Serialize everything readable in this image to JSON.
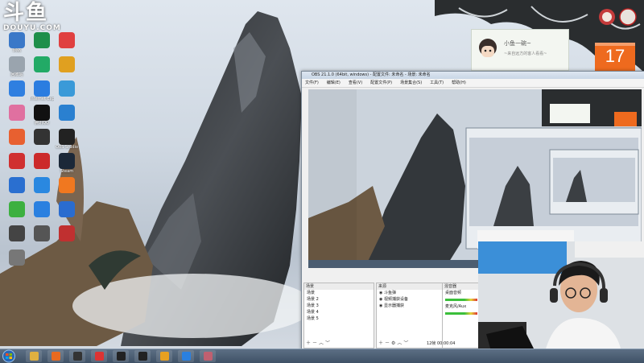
{
  "watermark": {
    "logo_chars": "斗鱼",
    "site": "DOUYU.COM"
  },
  "desktop_icons": [
    {
      "label": "网络",
      "color": "#3a78c8",
      "icon": "network-icon"
    },
    {
      "label": "",
      "color": "#1e8f4a",
      "icon": "app-icon"
    },
    {
      "label": "",
      "color": "#e04040",
      "icon": "app-icon"
    },
    {
      "label": "回收站",
      "color": "#9aa4ae",
      "icon": "recycle-bin-icon"
    },
    {
      "label": "",
      "color": "#22aa66",
      "icon": "wechat-icon"
    },
    {
      "label": "",
      "color": "#e0a020",
      "icon": "app-icon"
    },
    {
      "label": "",
      "color": "#2f7fe0",
      "icon": "app-icon"
    },
    {
      "label": "Internet Explorer",
      "color": "#2b7de0",
      "icon": "ie-icon"
    },
    {
      "label": "",
      "color": "#3a9ad8",
      "icon": "app-icon"
    },
    {
      "label": "",
      "color": "#e070a0",
      "icon": "app-icon"
    },
    {
      "label": "腾讯QQ",
      "color": "#111111",
      "icon": "qq-icon"
    },
    {
      "label": "",
      "color": "#2a80d0",
      "icon": "app-icon"
    },
    {
      "label": "",
      "color": "#e86030",
      "icon": "app-icon"
    },
    {
      "label": "",
      "color": "#333333",
      "icon": "app-icon"
    },
    {
      "label": "OBS Studio",
      "color": "#222222",
      "icon": "obs-icon"
    },
    {
      "label": "",
      "color": "#d03030",
      "icon": "app-icon"
    },
    {
      "label": "",
      "color": "#cc2a2a",
      "icon": "app-icon"
    },
    {
      "label": "Steam",
      "color": "#1b2838",
      "icon": "steam-icon"
    },
    {
      "label": "",
      "color": "#2a6fd0",
      "icon": "app-icon"
    },
    {
      "label": "",
      "color": "#2a88e0",
      "icon": "app-icon"
    },
    {
      "label": "",
      "color": "#f07820",
      "icon": "app-icon"
    },
    {
      "label": "",
      "color": "#3cb040",
      "icon": "app-icon"
    },
    {
      "label": "",
      "color": "#2a80e0",
      "icon": "app-icon"
    },
    {
      "label": "",
      "color": "#2a6ccf",
      "icon": "app-icon"
    },
    {
      "label": "",
      "color": "#444444",
      "icon": "app-icon"
    },
    {
      "label": "",
      "color": "#555555",
      "icon": "app-icon"
    },
    {
      "label": "",
      "color": "#c03030",
      "icon": "app-icon"
    },
    {
      "label": "",
      "color": "#777777",
      "icon": "app-icon"
    }
  ],
  "chat_widget": {
    "name": "小鱼一碗~",
    "status": "~来自远方的客人看看~"
  },
  "calendar": {
    "day": "17"
  },
  "obs": {
    "title": "OBS 21.1.0 (64bit, windows) - 配置文件: 未命名 - 场景: 未命名",
    "menu": [
      "文件(F)",
      "编辑(E)",
      "查看(V)",
      "配置文件(P)",
      "场景集合(S)",
      "工具(T)",
      "帮助(H)"
    ],
    "panels": {
      "scenes": {
        "header": "场景",
        "items": [
          "场景",
          "场景 2",
          "场景 3",
          "场景 4",
          "场景 5"
        ]
      },
      "sources": {
        "header": "来源",
        "items": [
          "斗鱼弹",
          "视频捕获设备",
          "显示器捕获"
        ]
      },
      "mixer": {
        "header": "混音器",
        "items": [
          "桌面音频",
          "麦克风/Aux"
        ]
      }
    },
    "status": "12帧  00:00:04"
  },
  "taskbar": {
    "start": "start-orb-icon",
    "apps": [
      {
        "icon": "explorer-icon",
        "color": "#e0b040"
      },
      {
        "icon": "firefox-icon",
        "color": "#e86a20"
      },
      {
        "icon": "cs-icon",
        "color": "#333333"
      },
      {
        "icon": "app-icon",
        "color": "#d33"
      },
      {
        "icon": "app-icon",
        "color": "#222"
      },
      {
        "icon": "obs-taskbar-icon",
        "color": "#222"
      },
      {
        "icon": "app-icon",
        "color": "#e8a020"
      },
      {
        "icon": "app-icon",
        "color": "#2a80e0"
      },
      {
        "icon": "app-icon",
        "color": "#c06070"
      }
    ]
  }
}
